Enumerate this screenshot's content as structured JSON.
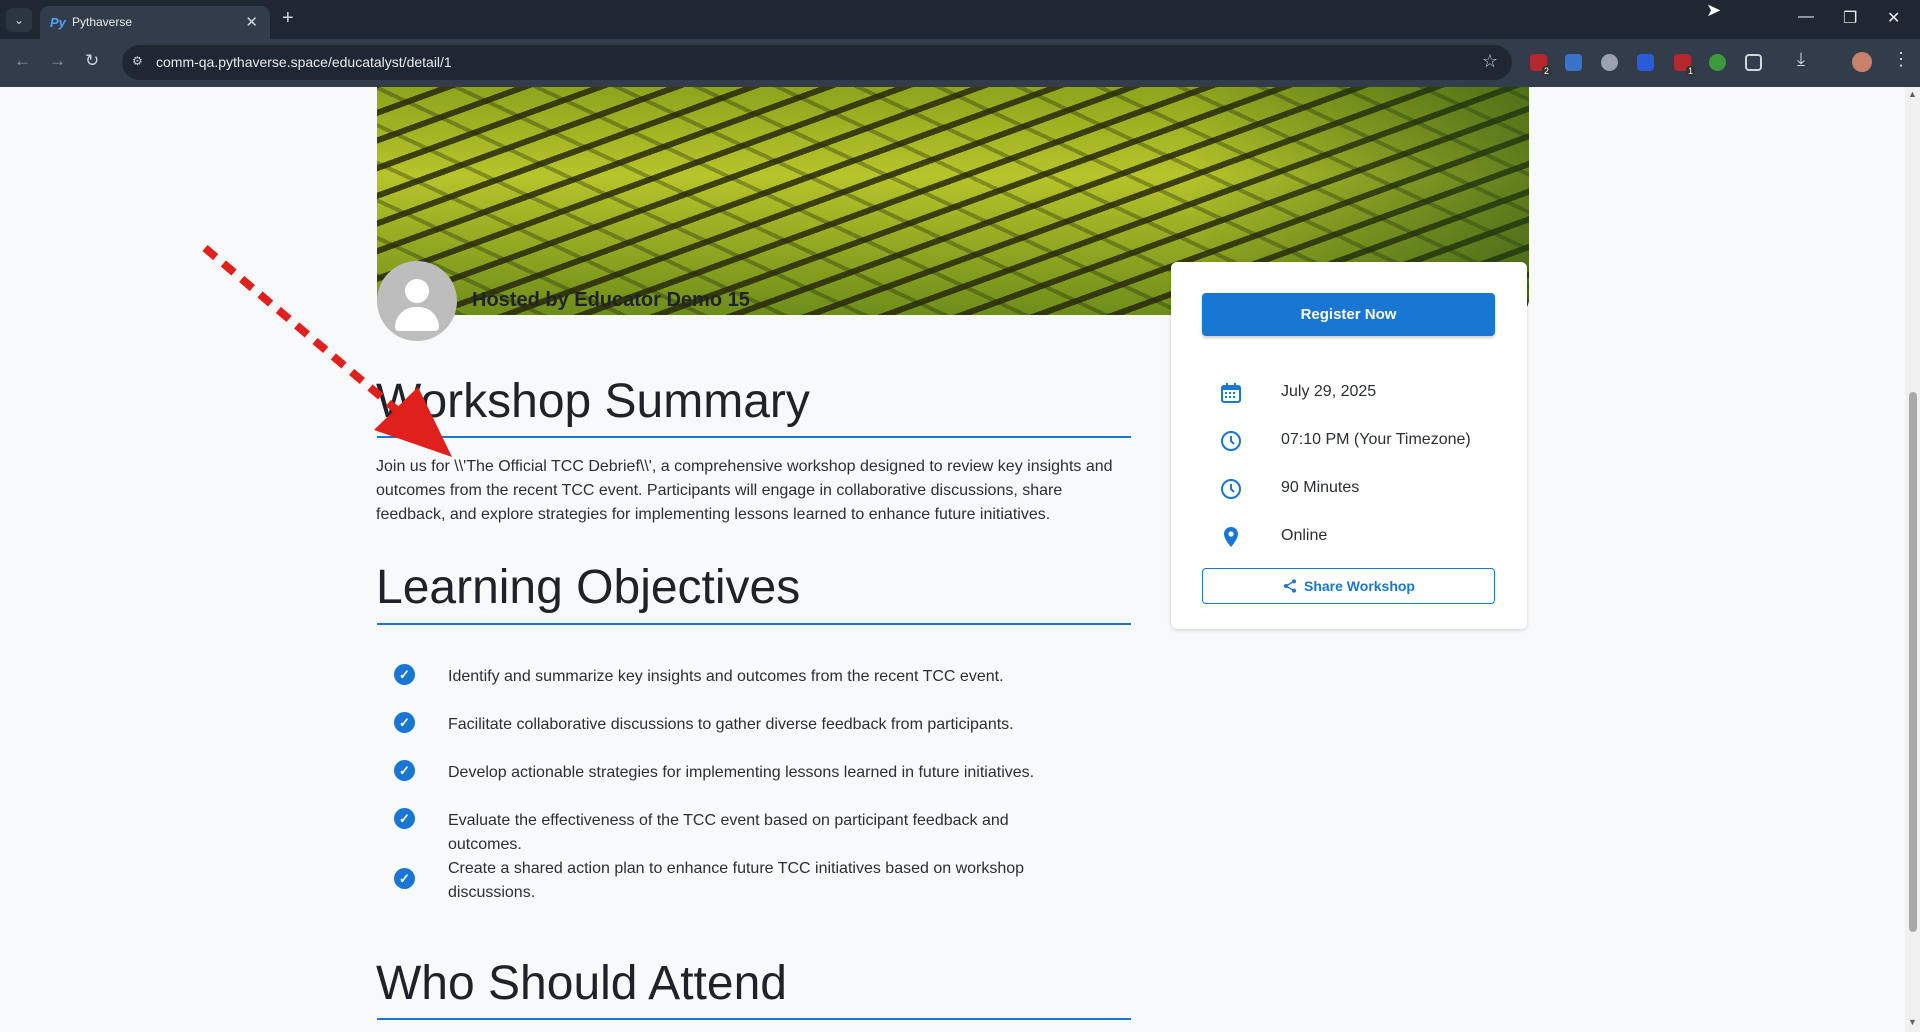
{
  "browser": {
    "tab_title": "Pythaverse",
    "tab_favicon_text": "Py",
    "url": "comm-qa.pythaverse.space/educatalyst/detail/1",
    "extension_badges": [
      "2",
      "1"
    ]
  },
  "host": {
    "label": "Hosted by Educator Demo 15"
  },
  "summary": {
    "heading": "Workshop Summary",
    "text": "Join us for \\\\'The Official TCC Debrief\\\\', a comprehensive workshop designed to review key insights and outcomes from the recent TCC event. Participants will engage in collaborative discussions, share feedback, and explore strategies for implementing lessons learned to enhance future initiatives."
  },
  "objectives": {
    "heading": "Learning Objectives",
    "items": [
      "Identify and summarize key insights and outcomes from the recent TCC event.",
      "Facilitate collaborative discussions to gather diverse feedback from participants.",
      "Develop actionable strategies for implementing lessons learned in future initiatives.",
      "Evaluate the effectiveness of the TCC event based on participant feedback and outcomes.",
      "Create a shared action plan to enhance future TCC initiatives based on workshop discussions."
    ]
  },
  "attend": {
    "heading": "Who Should Attend"
  },
  "sidebar": {
    "register_label": "Register Now",
    "date": "July 29, 2025",
    "time": "07:10 PM (Your Timezone)",
    "duration": "90 Minutes",
    "location": "Online",
    "share_label": "Share Workshop"
  },
  "colors": {
    "accent": "#1976d2",
    "annotation_arrow": "#e0201c",
    "chrome_dark": "#1f2733"
  }
}
